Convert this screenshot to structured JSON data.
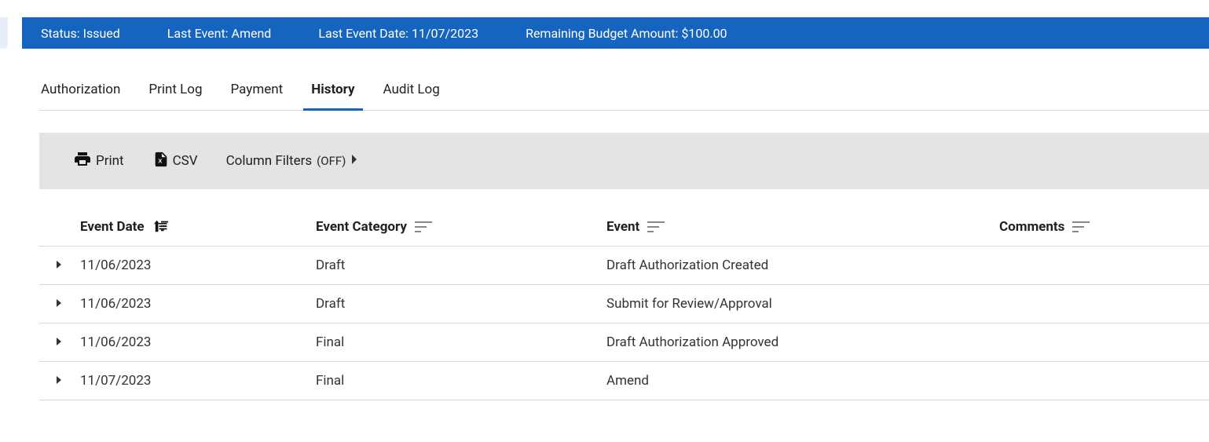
{
  "status_bar": {
    "status_label": "Status:",
    "status_value": "Issued",
    "last_event_label": "Last Event:",
    "last_event_value": "Amend",
    "last_event_date_label": "Last Event Date:",
    "last_event_date_value": "11/07/2023",
    "remaining_budget_label": "Remaining Budget Amount:",
    "remaining_budget_value": "$100.00"
  },
  "tabs": {
    "authorization": "Authorization",
    "print_log": "Print Log",
    "payment": "Payment",
    "history": "History",
    "audit_log": "Audit Log"
  },
  "toolbar": {
    "print": "Print",
    "csv": "CSV",
    "column_filters_label": "Column Filters",
    "column_filters_state": "(OFF)"
  },
  "table": {
    "headers": {
      "event_date": "Event Date",
      "event_category": "Event Category",
      "event": "Event",
      "comments": "Comments"
    },
    "rows": [
      {
        "date": "11/06/2023",
        "category": "Draft",
        "event": "Draft Authorization Created",
        "comments": ""
      },
      {
        "date": "11/06/2023",
        "category": "Draft",
        "event": "Submit for Review/Approval",
        "comments": ""
      },
      {
        "date": "11/06/2023",
        "category": "Final",
        "event": "Draft Authorization Approved",
        "comments": ""
      },
      {
        "date": "11/07/2023",
        "category": "Final",
        "event": "Amend",
        "comments": ""
      }
    ]
  }
}
